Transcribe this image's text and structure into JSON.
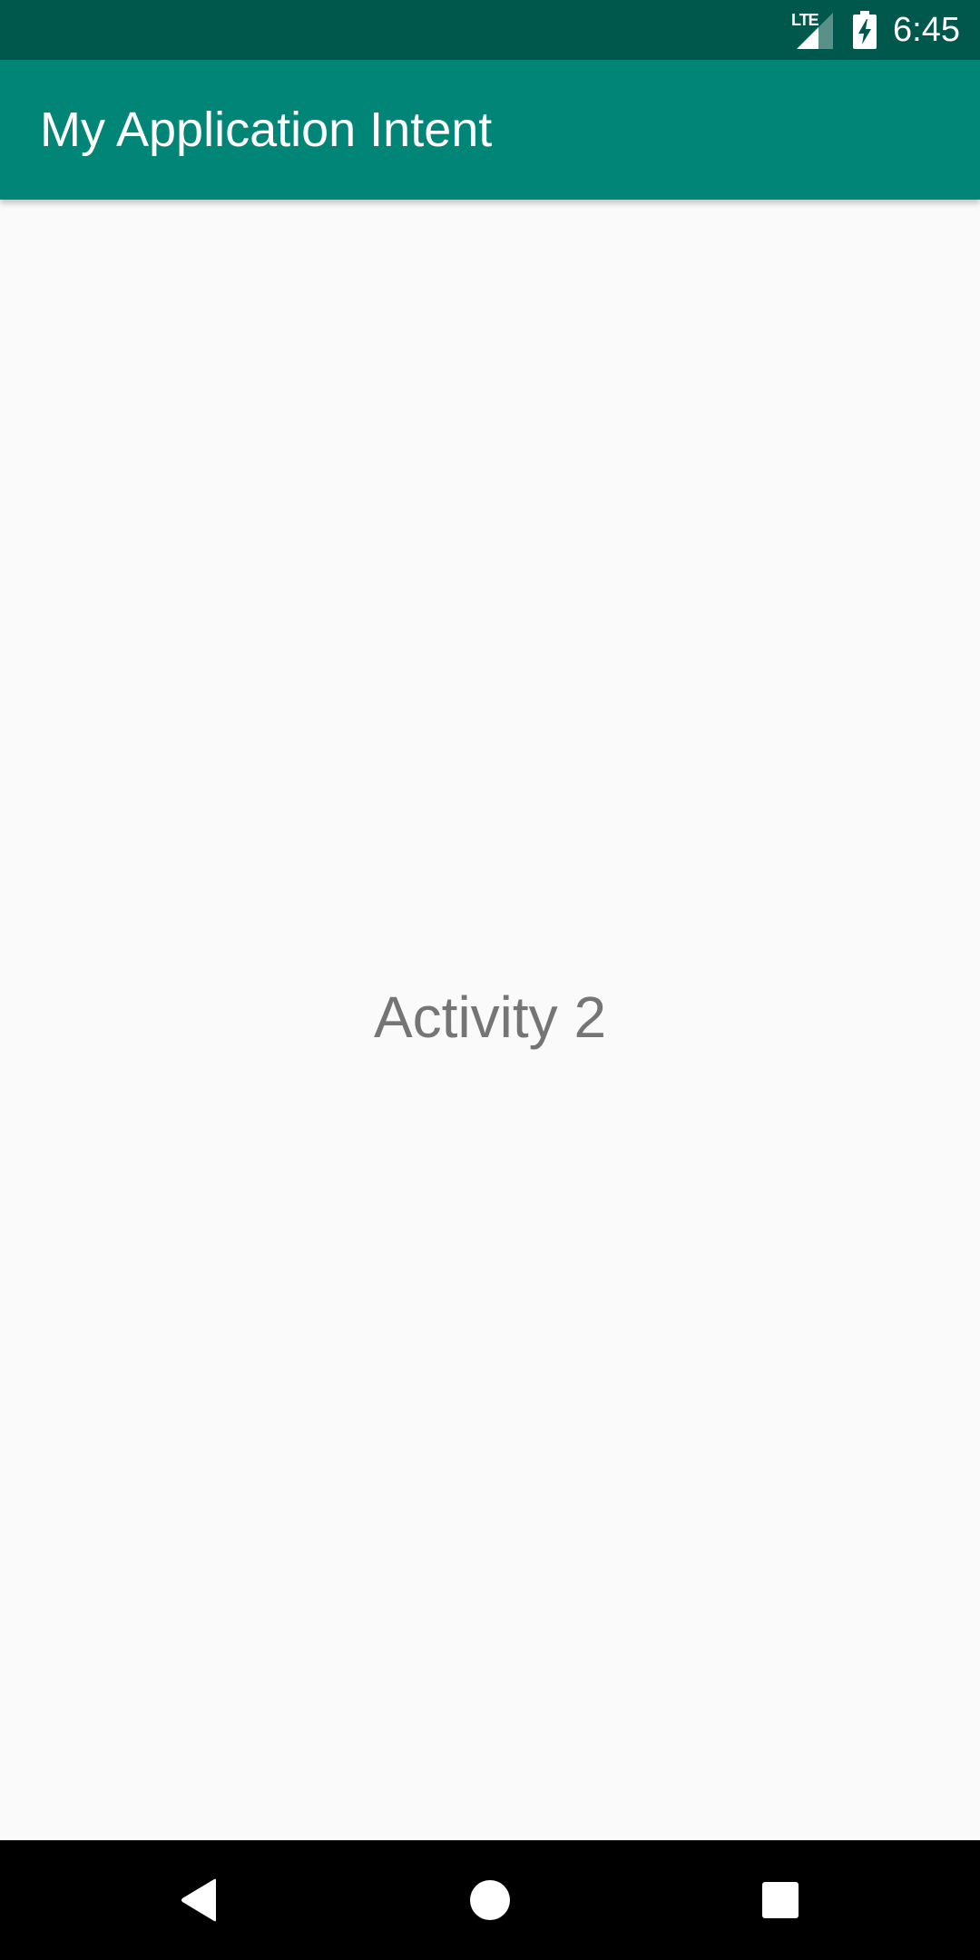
{
  "status_bar": {
    "network_label": "LTE",
    "time": "6:45",
    "icons": [
      "lte-signal-icon",
      "battery-charging-icon"
    ]
  },
  "app_bar": {
    "title": "My Application Intent"
  },
  "main": {
    "label": "Activity 2"
  },
  "nav_bar": {
    "buttons": [
      "back-icon",
      "home-icon",
      "recents-icon"
    ]
  },
  "colors": {
    "status_bar": "#00574b",
    "app_bar": "#008577",
    "background": "#fafafa",
    "text_secondary": "#757575",
    "nav_bar": "#000000"
  }
}
